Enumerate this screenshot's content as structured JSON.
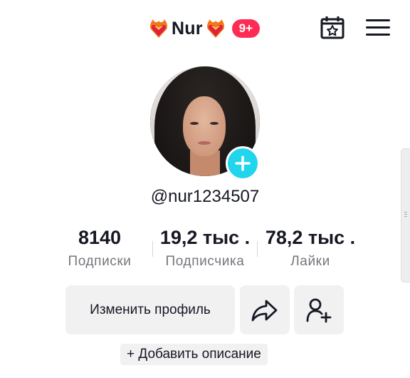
{
  "header": {
    "title": "Nur",
    "badge": "9+",
    "left_icon": "fire-heart-icon",
    "right_icon": "fire-heart-icon",
    "calendar_icon": "calendar-star-icon",
    "menu_icon": "hamburger-menu-icon"
  },
  "profile": {
    "username": "@nur1234507",
    "avatar_icon": "avatar-photo",
    "add_icon": "plus-icon",
    "stats": [
      {
        "value": "8140",
        "label": "Подписки"
      },
      {
        "value": "19,2 тыс .",
        "label": "Подписчика"
      },
      {
        "value": "78,2 тыс .",
        "label": "Лайки"
      }
    ]
  },
  "actions": {
    "edit_profile": "Изменить профиль",
    "share_icon": "share-arrow-icon",
    "add_friend_icon": "add-user-icon",
    "add_description": "+ Добавить описание"
  },
  "colors": {
    "accent_pink": "#fe2c55",
    "accent_cyan": "#20d5ec",
    "button_bg": "#f1f1f2",
    "muted_text": "#75767c"
  }
}
